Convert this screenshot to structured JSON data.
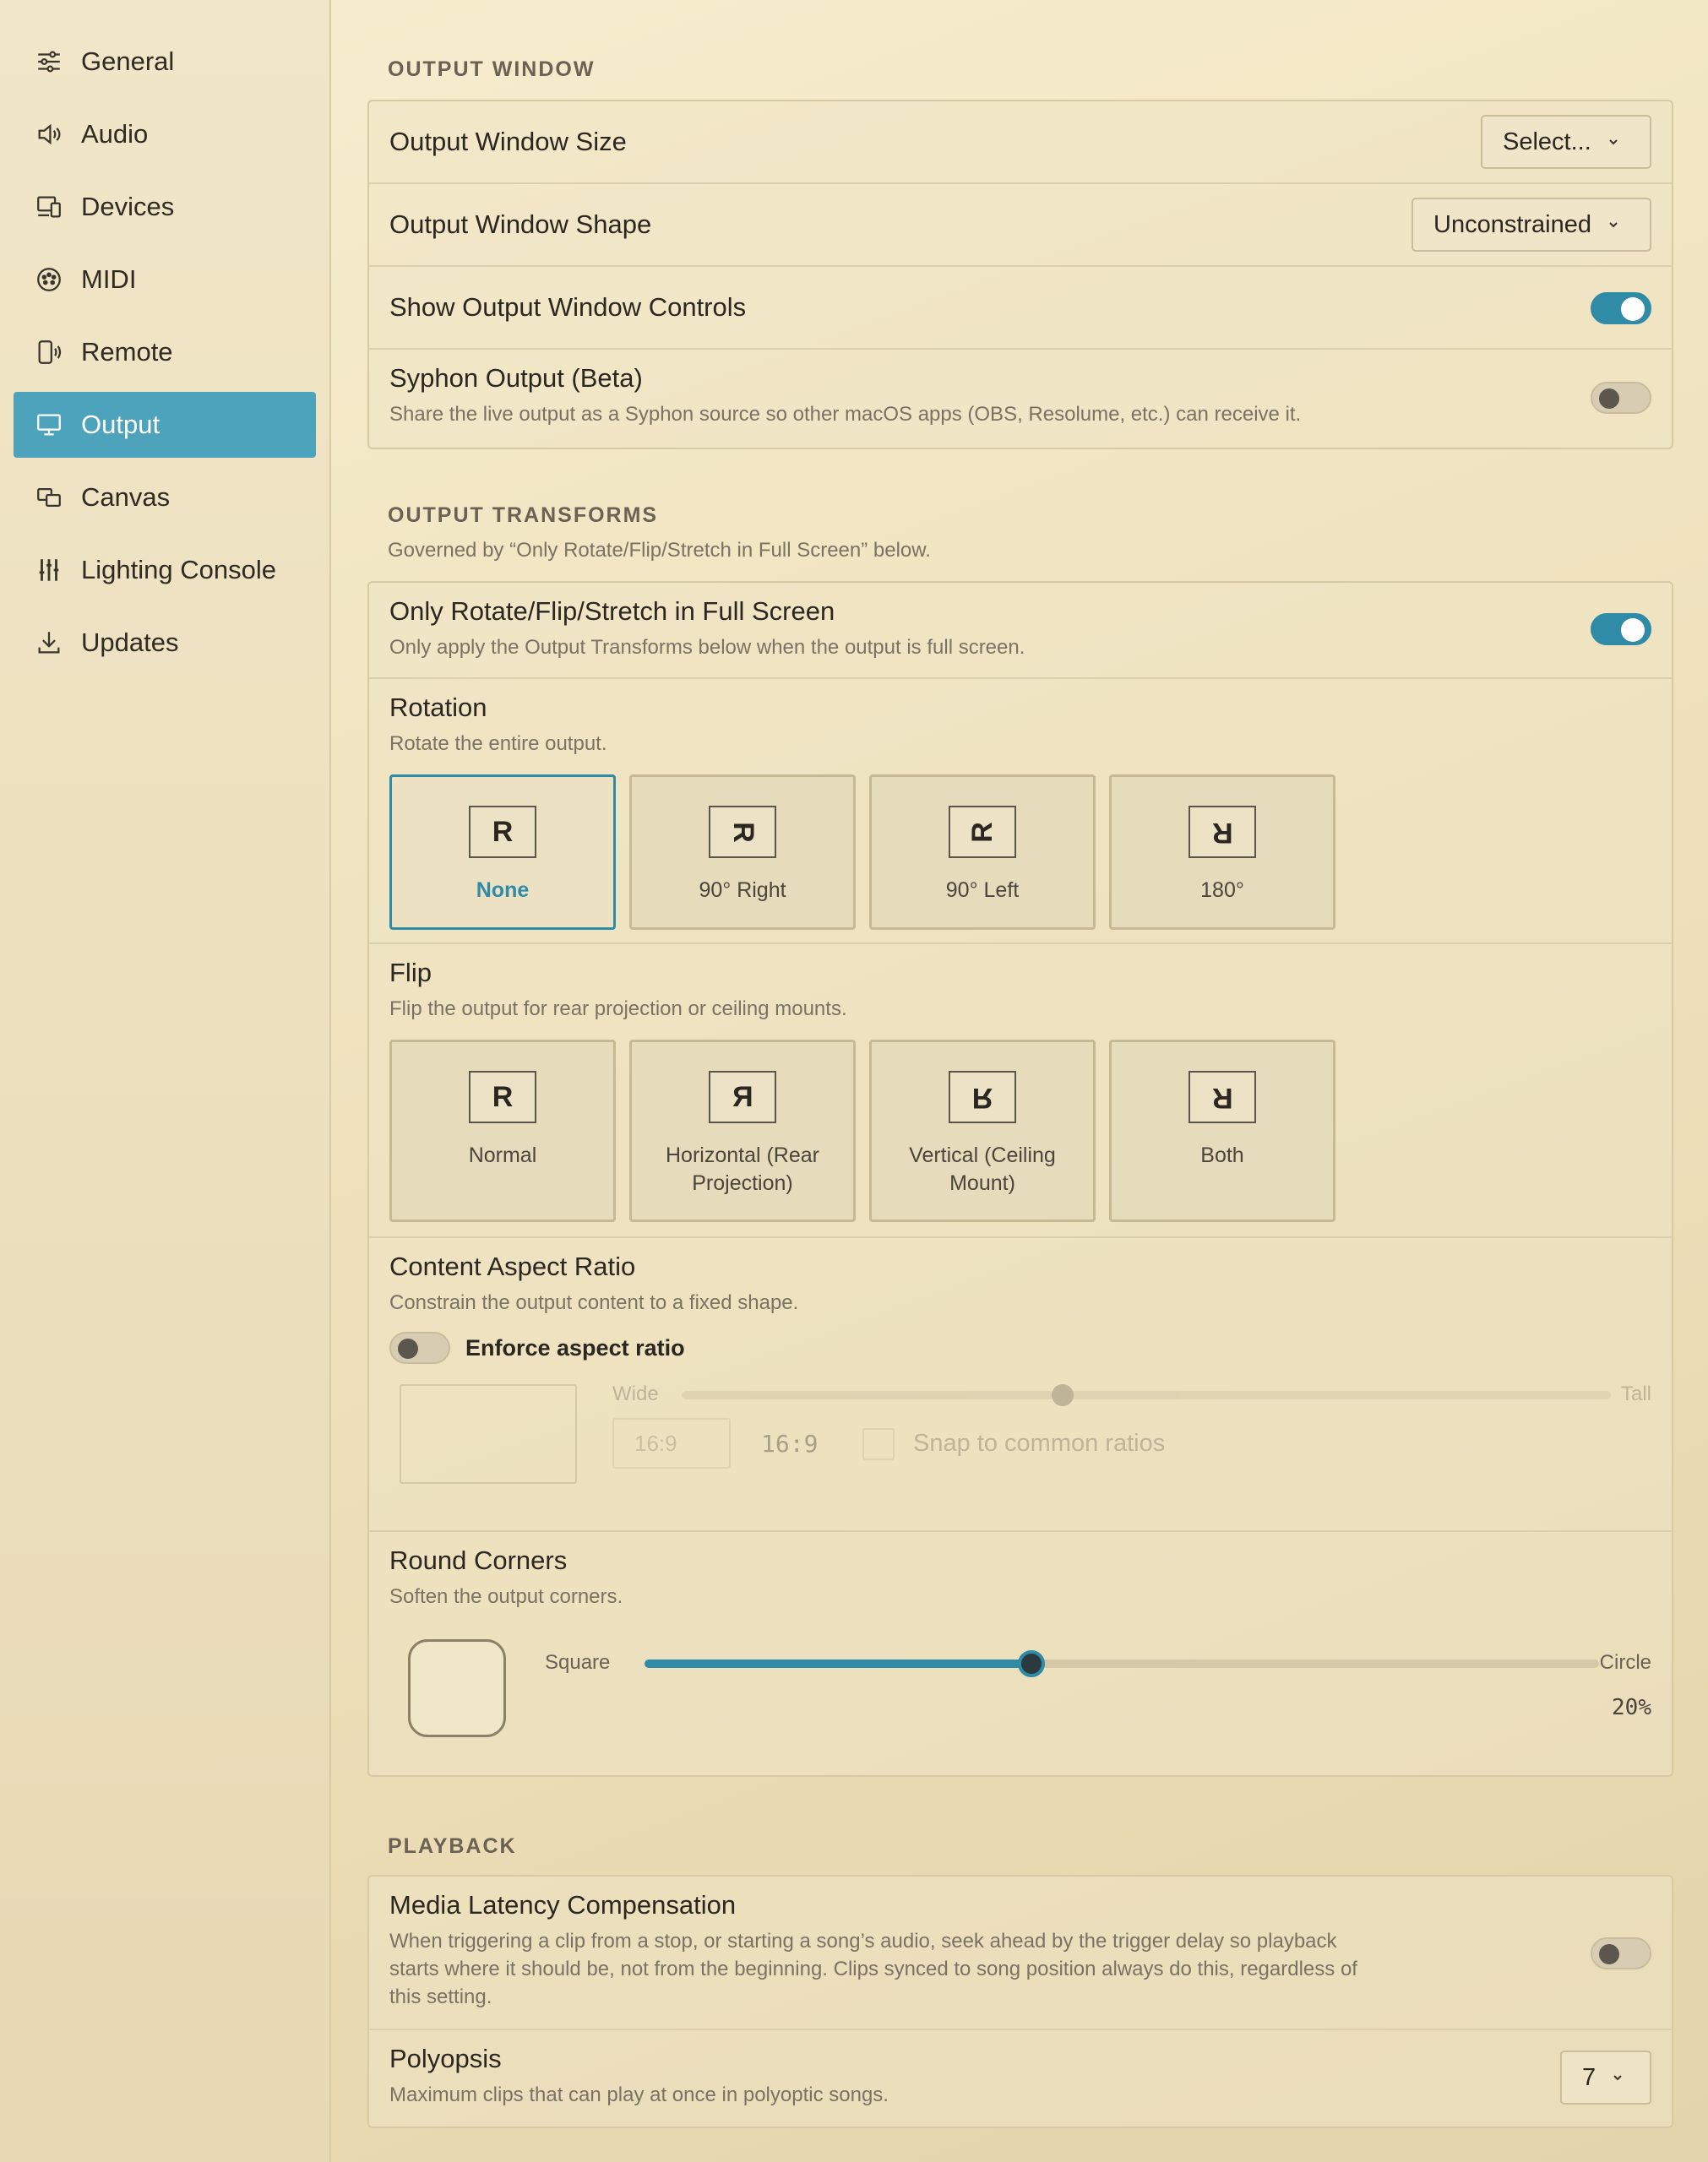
{
  "sidebar": {
    "items": [
      {
        "label": "General",
        "icon": "sliders-icon"
      },
      {
        "label": "Audio",
        "icon": "speaker-icon"
      },
      {
        "label": "Devices",
        "icon": "devices-icon"
      },
      {
        "label": "MIDI",
        "icon": "midi-icon"
      },
      {
        "label": "Remote",
        "icon": "remote-icon"
      },
      {
        "label": "Output",
        "icon": "monitor-icon",
        "active": true
      },
      {
        "label": "Canvas",
        "icon": "canvas-icon"
      },
      {
        "label": "Lighting Console",
        "icon": "faders-icon"
      },
      {
        "label": "Updates",
        "icon": "download-icon"
      }
    ]
  },
  "output_window": {
    "section_title": "OUTPUT WINDOW",
    "size_label": "Output Window Size",
    "size_value": "Select...",
    "shape_label": "Output Window Shape",
    "shape_value": "Unconstrained",
    "controls_label": "Show Output Window Controls",
    "controls_on": true,
    "syphon_label": "Syphon Output (Beta)",
    "syphon_desc": "Share the live output as a Syphon source so other macOS apps (OBS, Resolume, etc.) can receive it.",
    "syphon_on": false
  },
  "transforms": {
    "section_title": "OUTPUT TRANSFORMS",
    "section_sub": "Governed by “Only Rotate/Flip/Stretch in Full Screen” below.",
    "fullscreen_label": "Only Rotate/Flip/Stretch in Full Screen",
    "fullscreen_desc": "Only apply the Output Transforms below when the output is full screen.",
    "fullscreen_on": true,
    "rotation": {
      "title": "Rotation",
      "desc": "Rotate the entire output.",
      "options": [
        {
          "glyph": "R",
          "label": "None",
          "selected": true
        },
        {
          "glyph": "R",
          "label": "90° Right"
        },
        {
          "glyph": "R",
          "label": "90° Left"
        },
        {
          "glyph": "R",
          "label": "180°"
        }
      ]
    },
    "flip": {
      "title": "Flip",
      "desc": "Flip the output for rear projection or ceiling mounts.",
      "options": [
        {
          "glyph": "R",
          "label": "Normal"
        },
        {
          "glyph": "R",
          "label": "Horizontal (Rear Projection)"
        },
        {
          "glyph": "R",
          "label": "Vertical (Ceiling Mount)"
        },
        {
          "glyph": "R",
          "label": "Both"
        }
      ]
    },
    "aspect": {
      "title": "Content Aspect Ratio",
      "desc": "Constrain the output content to a fixed shape.",
      "enforce_label": "Enforce aspect ratio",
      "enforce_on": false,
      "wide_label": "Wide",
      "tall_label": "Tall",
      "slider_fraction": 0.41,
      "ratio_input": "16:9",
      "ratio_display": "16:9",
      "snap_label": "Snap to common ratios"
    },
    "corners": {
      "title": "Round Corners",
      "desc": "Soften the output corners.",
      "square_label": "Square",
      "circle_label": "Circle",
      "value_fraction": 0.405,
      "value_display": "20%"
    }
  },
  "playback": {
    "section_title": "PLAYBACK",
    "latency_label": "Media Latency Compensation",
    "latency_desc": "When triggering a clip from a stop, or starting a song’s audio, seek ahead by the trigger delay so playback starts where it should be, not from the beginning. Clips synced to song position always do this, regardless of this setting.",
    "latency_on": false,
    "polyopsis_label": "Polyopsis",
    "polyopsis_desc": "Maximum clips that can play at once in polyoptic songs.",
    "polyopsis_value": "7"
  },
  "colors": {
    "accent": "#2f8ba6",
    "sidebar_active": "#4da3bc"
  }
}
